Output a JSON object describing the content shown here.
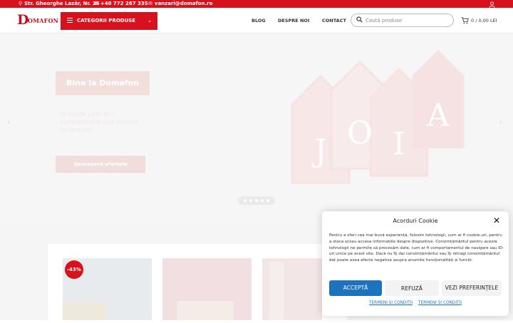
{
  "topbar": {
    "address": "Str. Gheorghe Lazăr, Nr. 26",
    "phone": "+40 772 267 335",
    "email": "vanzari@domafon.ro"
  },
  "header": {
    "logo_letter": "D",
    "logo_text": "OMAFON",
    "categories_label": "CATEGORII PRODUSE",
    "nav": [
      "BLOG",
      "DESPRE NOI",
      "CONTACT"
    ],
    "search_placeholder": "Caută produse",
    "cart_count": "0",
    "cart_total": "0,00 LEI"
  },
  "hero": {
    "title": "Bine la Domafon",
    "paragraph": "Ai ocazia sa iti faci cumparaturile usor si rapid cu reduceri",
    "cta": "Descopera ofertele"
  },
  "products": [
    {
      "discount": "-43%",
      "color": "#e9ecef"
    },
    {
      "discount": "",
      "color": "#f2e2e4"
    },
    {
      "discount": "",
      "color": "#f3e7e7"
    }
  ],
  "cookie": {
    "title": "Acorduri Cookie",
    "body": "Pentru a oferi cea mai bună experiență, folosim tehnologii, cum ar fi cookie-uri, pentru a stoca și/sau accesa informațiile despre dispozitive. Consimțământul pentru aceste tehnologii ne permite să procesăm date, cum ar fi comportamentul de navigare sau ID-uri unice pe acest site. Dacă nu îți dai consimțământul sau îți retragi consimțământul dat poate avea afecte negative asupra anumite funcționalități și funcții.",
    "accept": "ACCEPTĂ",
    "refuse": "REFUZĂ",
    "preferences": "VEZI PREFERINȚELE",
    "link1": "TERMENI ȘI CONDIȚII",
    "link2": "TERMENI ȘI CONDIȚII"
  },
  "colors": {
    "brand_red": "#d7121c",
    "accept_blue": "#1e73be"
  }
}
